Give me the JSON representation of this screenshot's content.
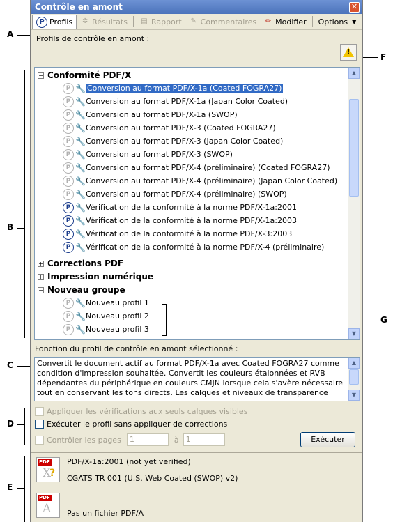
{
  "callouts": {
    "a": "A",
    "b": "B",
    "c": "C",
    "d": "D",
    "e": "E",
    "f": "F",
    "g": "G"
  },
  "window": {
    "title": "Contrôle en amont",
    "close_icon": "close-icon"
  },
  "toolbar": {
    "profils": "Profils",
    "resultats": "Résultats",
    "rapport": "Rapport",
    "commentaires": "Commentaires",
    "modifier": "Modifier",
    "options": "Options"
  },
  "profiles_label": "Profils de contrôle en amont :",
  "tree": {
    "group1": "Conformité PDF/X",
    "items1": [
      "Conversion au format PDF/X-1a (Coated FOGRA27)",
      "Conversion au format PDF/X-1a (Japan Color Coated)",
      "Conversion au format PDF/X-1a (SWOP)",
      "Conversion au format PDF/X-3 (Coated FOGRA27)",
      "Conversion au format PDF/X-3 (Japan Color Coated)",
      "Conversion au format PDF/X-3 (SWOP)",
      "Conversion au format PDF/X-4 (préliminaire) (Coated FOGRA27)",
      "Conversion au format PDF/X-4 (préliminaire) (Japan Color Coated)",
      "Conversion au format PDF/X-4 (préliminaire) (SWOP)",
      "Vérification de la conformité à la norme PDF/X-1a:2001",
      "Vérification de la conformité à la norme PDF/X-1a:2003",
      "Vérification de la conformité à la norme PDF/X-3:2003",
      "Vérification de la conformité à la norme PDF/X-4 (préliminaire)"
    ],
    "group2": "Corrections PDF",
    "group3": "Impression numérique",
    "group4": "Nouveau groupe",
    "items4": [
      "Nouveau profil 1",
      "Nouveau profil 2",
      "Nouveau profil 3"
    ]
  },
  "description": {
    "label": "Fonction du profil de contrôle en amont sélectionné :",
    "text": "Convertit le document actif au format PDF/X-1a avec Coated FOGRA27 comme condition d'impression souhaitée. Convertit les couleurs étalonnées et RVB dépendantes du périphérique en couleurs CMJN lorsque cela s'avère nécessaire tout en conservant les tons directs. Les calques et niveaux de transparence"
  },
  "options": {
    "visible_layers": "Appliquer les vérifications aux seuls calques visibles",
    "no_fixups": "Exécuter le profil sans appliquer de corrections",
    "check_pages": "Contrôler les pages",
    "page_from": "1",
    "page_to_label": "à",
    "page_to": "1",
    "run": "Exécuter"
  },
  "status": {
    "line1": "PDF/X-1a:2001 (not yet verified)",
    "line2": "CGATS TR 001 (U.S. Web Coated (SWOP) v2)",
    "line3": "Pas un fichier PDF/A",
    "pdf_badge": "PDF"
  }
}
